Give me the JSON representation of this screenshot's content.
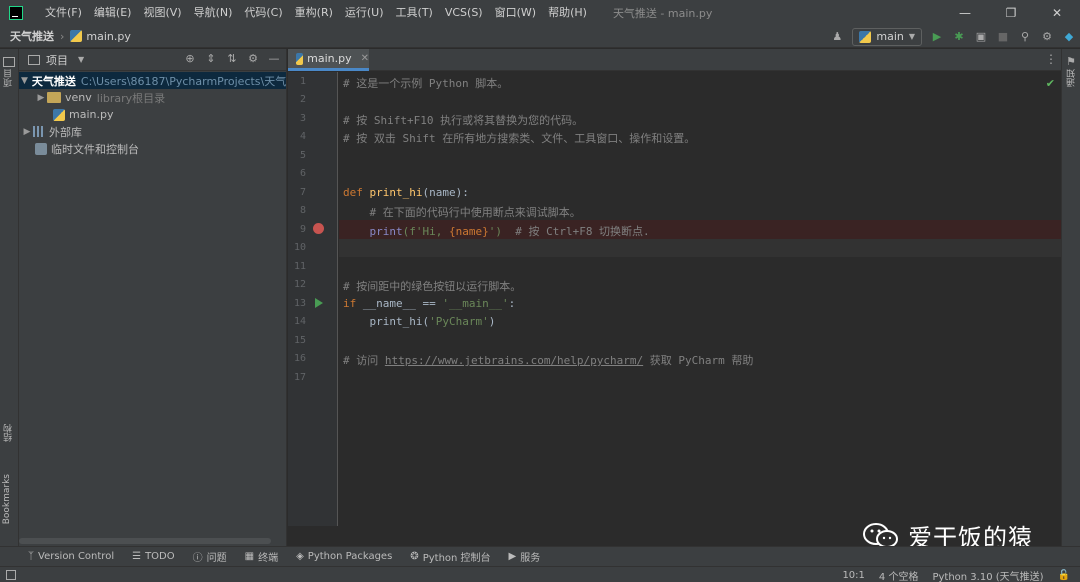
{
  "window": {
    "title": "天气推送 - main.py"
  },
  "menu": [
    "文件(F)",
    "编辑(E)",
    "视图(V)",
    "导航(N)",
    "代码(C)",
    "重构(R)",
    "运行(U)",
    "工具(T)",
    "VCS(S)",
    "窗口(W)",
    "帮助(H)"
  ],
  "navbar": {
    "project": "天气推送",
    "file": "main.py",
    "branch": "main"
  },
  "left_strip": {
    "top": "项目",
    "middle": "结构",
    "bottom": "Bookmarks"
  },
  "right_strip": {
    "top": "通知"
  },
  "project_panel": {
    "title": "项目",
    "tree": [
      {
        "label": "天气推送",
        "extra": "C:\\Users\\86187\\PycharmProjects\\天气推",
        "selected": true
      },
      {
        "label": "venv",
        "extra": "library根目录"
      },
      {
        "label": "main.py",
        "extra": ""
      },
      {
        "label": "外部库",
        "extra": ""
      },
      {
        "label": "临时文件和控制台",
        "extra": ""
      }
    ]
  },
  "editor": {
    "tab_label": "main.py",
    "line_numbers": [
      "1",
      "2",
      "3",
      "4",
      "5",
      "6",
      "7",
      "8",
      "9",
      "10",
      "11",
      "12",
      "13",
      "14",
      "15",
      "16",
      "17"
    ],
    "lines": {
      "l1": "# 这是一个示例 Python 脚本。",
      "l3": "# 按 Shift+F10 执行或将其替换为您的代码。",
      "l4": "# 按 双击 Shift 在所有地方搜索类、文件、工具窗口、操作和设置。",
      "l7_kw": "def ",
      "l7_fn": "print_hi",
      "l7_rest": "(name):",
      "l8": "    # 在下面的代码行中使用断点来调试脚本。",
      "l9_fn": "    print",
      "l9_str1": "(f'Hi, ",
      "l9_brace": "{name}",
      "l9_str2": "')",
      "l9_cm": "  # 按 Ctrl+F8 切换断点.",
      "l12": "# 按间距中的绿色按钮以运行脚本。",
      "l13_kw": "if ",
      "l13_mid": "__name__ == ",
      "l13_str": "'__main__'",
      "l13_end": ":",
      "l14_fn": "    print_hi(",
      "l14_str": "'PyCharm'",
      "l14_end": ")",
      "l16_cm": "# 访问 ",
      "l16_url": "https://www.jetbrains.com/help/pycharm/",
      "l16_end": " 获取 PyCharm 帮助"
    }
  },
  "tool_windows": [
    "Version Control",
    "TODO",
    "问题",
    "终端",
    "Python Packages",
    "Python 控制台",
    "服务"
  ],
  "status": {
    "position": "10:1",
    "indent": "4 个空格",
    "interpreter": "Python 3.10 (天气推送)"
  },
  "watermark": {
    "text": "爱干饭的猿"
  },
  "colors": {
    "accent": "#4a88c7",
    "breakpoint": "#c75450",
    "run": "#499c54"
  }
}
